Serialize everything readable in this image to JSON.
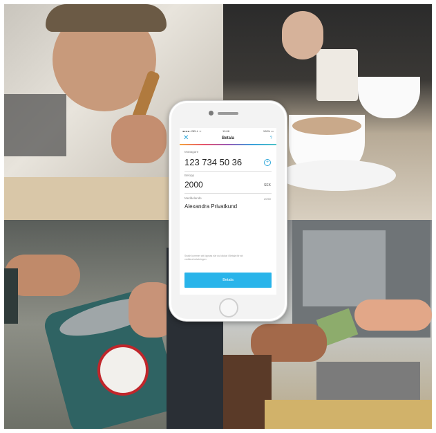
{
  "phone_screen": {
    "status_bar": {
      "carrier": "●●●●○ BELL ᯤ",
      "time": "10:08",
      "battery": "100% ▭"
    },
    "nav": {
      "close_label": "✕",
      "title": "Betala",
      "help_label": "?"
    },
    "recipient": {
      "label": "Mottagare",
      "value": "123 734 50 36",
      "add_icon": "plus-circle-icon"
    },
    "amount": {
      "label": "Belopp",
      "value": "2000",
      "currency": "SEK"
    },
    "message": {
      "label": "Meddelande",
      "value": "Alexandra Privatkund",
      "char_count": "20/50"
    },
    "note": "Swish kommer att öppnas när du klickat i Betala för att verifiera betalningen",
    "pay_button_label": "Betala"
  },
  "colors": {
    "accent": "#29b4ea",
    "icon_blue": "#2ba6d9"
  }
}
